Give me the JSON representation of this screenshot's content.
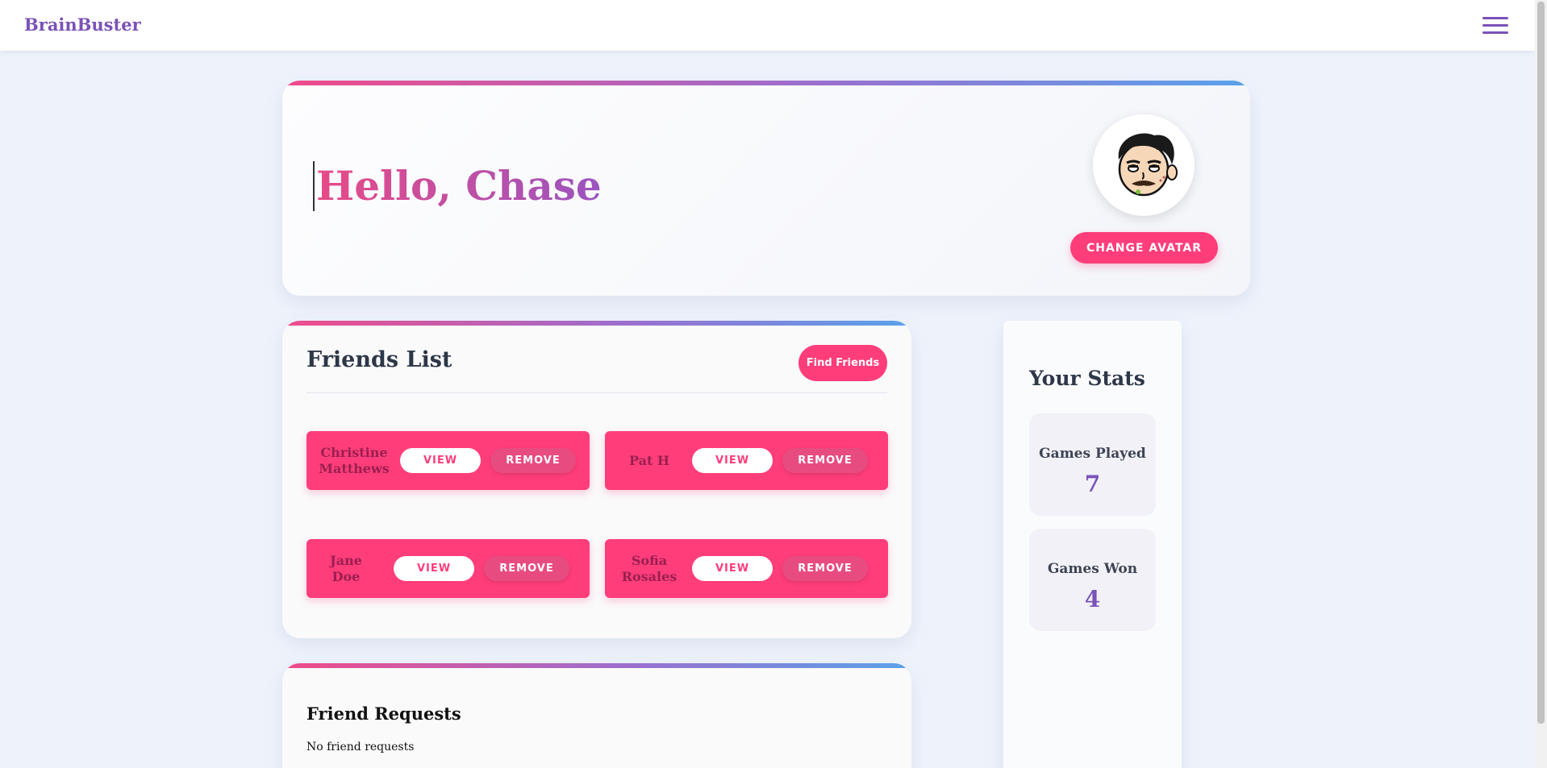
{
  "app": {
    "brand": "BrainBuster"
  },
  "hero": {
    "greeting": "Hello, Chase",
    "change_avatar_label": "CHANGE AVATAR"
  },
  "friends": {
    "title": "Friends List",
    "find_label": "Find Friends",
    "view_label": "VIEW",
    "remove_label": "REMOVE",
    "items": [
      {
        "name": "Christine Matthews"
      },
      {
        "name": "Pat H"
      },
      {
        "name": "Jane Doe"
      },
      {
        "name": "Sofia Rosales"
      }
    ]
  },
  "requests": {
    "title": "Friend Requests",
    "empty_text": "No friend requests"
  },
  "stats": {
    "title": "Your Stats",
    "items": [
      {
        "label": "Games Played",
        "value": "7"
      },
      {
        "label": "Games Won",
        "value": "4"
      }
    ]
  },
  "colors": {
    "accent": "#ff3d7a",
    "brand": "#7b52b8"
  }
}
